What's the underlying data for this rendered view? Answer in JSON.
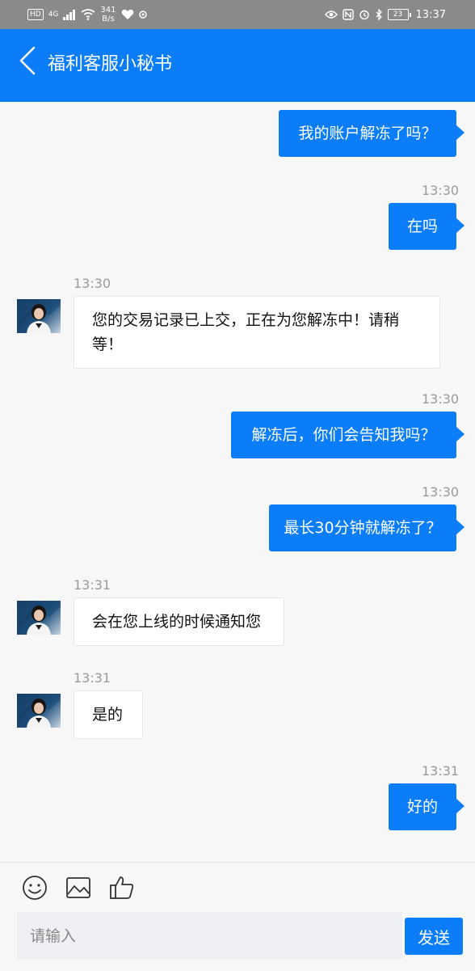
{
  "status_bar": {
    "hd": "HD",
    "signal_type": "4G",
    "speed_value": "341",
    "speed_unit": "B/s",
    "battery": "23",
    "time": "13:37"
  },
  "header": {
    "title": "福利客服小秘书"
  },
  "messages": [
    {
      "sender": "me",
      "time": "",
      "text": "我的账户解冻了吗？"
    },
    {
      "sender": "me",
      "time": "13:30",
      "text": "在吗"
    },
    {
      "sender": "bot",
      "time": "13:30",
      "line1": "您的交易记录已上交，正在为您解冻中！请稍",
      "line2": "等！"
    },
    {
      "sender": "me",
      "time": "13:30",
      "text": "解冻后，你们会告知我吗？"
    },
    {
      "sender": "me",
      "time": "13:30",
      "text": "最长30分钟就解冻了？"
    },
    {
      "sender": "bot",
      "time": "13:31",
      "text": "会在您上线的时候通知您"
    },
    {
      "sender": "bot",
      "time": "13:31",
      "text": "是的"
    },
    {
      "sender": "me",
      "time": "13:31",
      "text": "好的"
    }
  ],
  "composer": {
    "placeholder": "请输入",
    "send_label": "发送"
  },
  "colors": {
    "accent": "#0b7df8",
    "status_bar_bg": "#8a8a8a",
    "chat_bg": "#f7f7f7"
  }
}
